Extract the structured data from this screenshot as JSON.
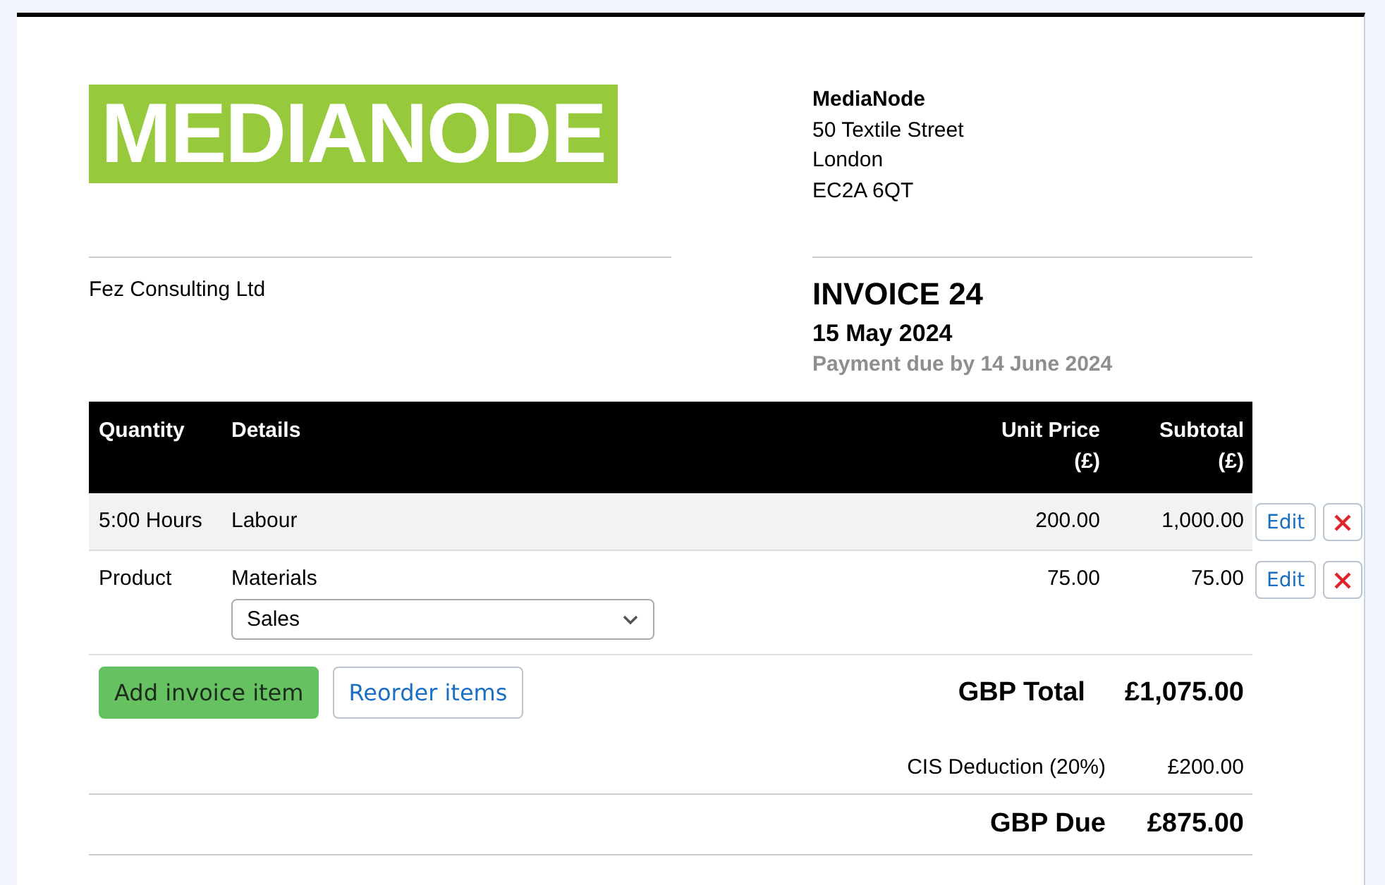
{
  "logo": {
    "text": "MEDIANODE"
  },
  "supplier": {
    "name": "MediaNode",
    "address": [
      "50 Textile Street",
      "London",
      "EC2A 6QT"
    ]
  },
  "client": {
    "name": "Fez Consulting Ltd"
  },
  "invoice": {
    "title": "INVOICE 24",
    "date": "15 May 2024",
    "due": "Payment due by 14 June 2024"
  },
  "table": {
    "columns": [
      "Quantity",
      "Details",
      "Unit Price (£)",
      "Subtotal (£)"
    ],
    "rows": [
      {
        "quantity": "5:00 Hours",
        "details": "Labour",
        "unit_price": "200.00",
        "subtotal": "1,000.00",
        "highlighted": true,
        "edit": "Edit"
      },
      {
        "quantity": "Product",
        "details": "Materials",
        "account": "Sales",
        "unit_price": "75.00",
        "subtotal": "75.00",
        "highlighted": false,
        "edit": "Edit"
      }
    ]
  },
  "buttons": [
    {
      "label": "Add invoice item",
      "kind": "primary"
    },
    {
      "label": "Reorder items",
      "kind": "secondary"
    }
  ],
  "totals": [
    {
      "label": "GBP Total",
      "value": "£1,075.00",
      "kind": "total"
    },
    {
      "label": "CIS Deduction (20%)",
      "value": "£200.00",
      "kind": "deduction"
    },
    {
      "label": "GBP Due",
      "value": "£875.00",
      "kind": "due"
    }
  ]
}
